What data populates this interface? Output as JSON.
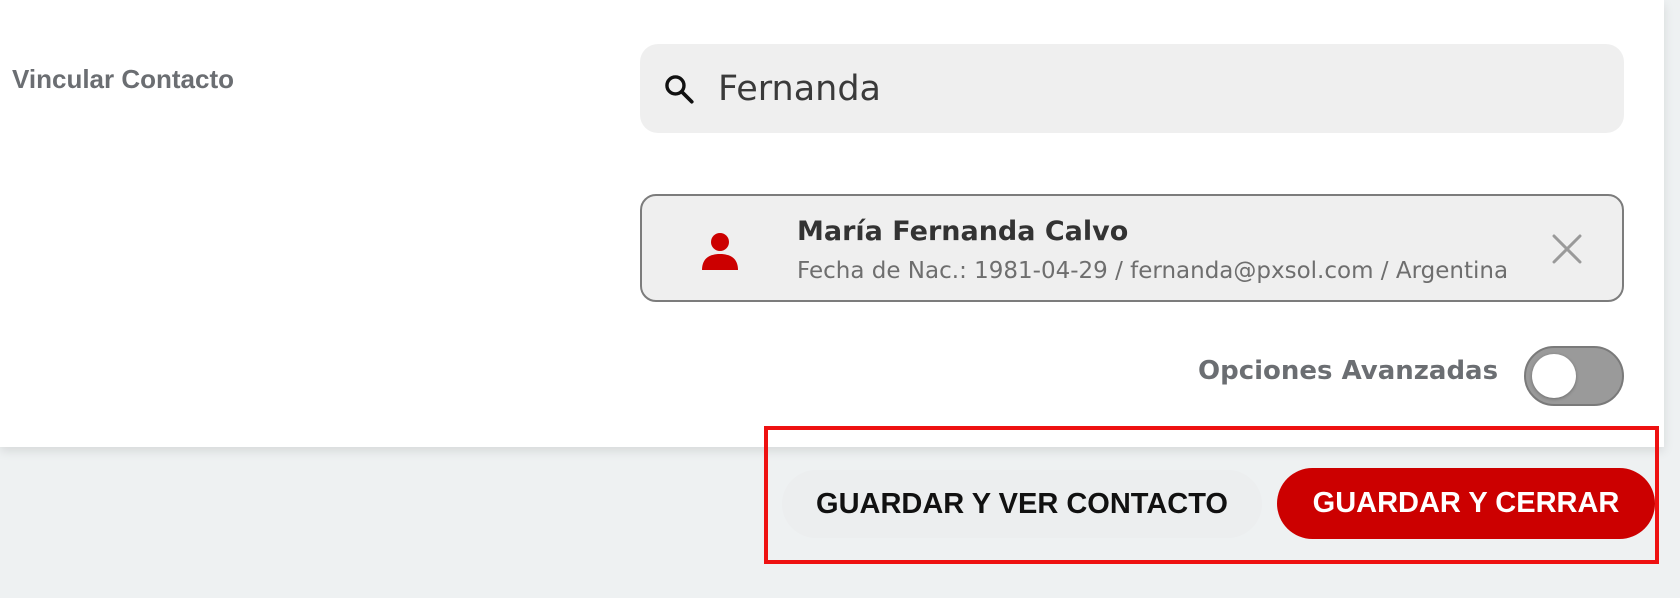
{
  "form": {
    "link_contact_label": "Vincular Contacto",
    "search": {
      "value": "Fernanda",
      "placeholder": ""
    }
  },
  "selected_contact": {
    "name": "María Fernanda Calvo",
    "details": "Fecha de Nac.: 1981-04-29 / fernanda@pxsol.com / Argentina",
    "icon": "person-icon",
    "icon_color": "#cc0000"
  },
  "advanced_options": {
    "label": "Opciones Avanzadas",
    "enabled": false
  },
  "actions": {
    "save_view_label": "GUARDAR Y VER CONTACTO",
    "save_close_label": "GUARDAR Y CERRAR",
    "primary_color": "#cc0000"
  }
}
